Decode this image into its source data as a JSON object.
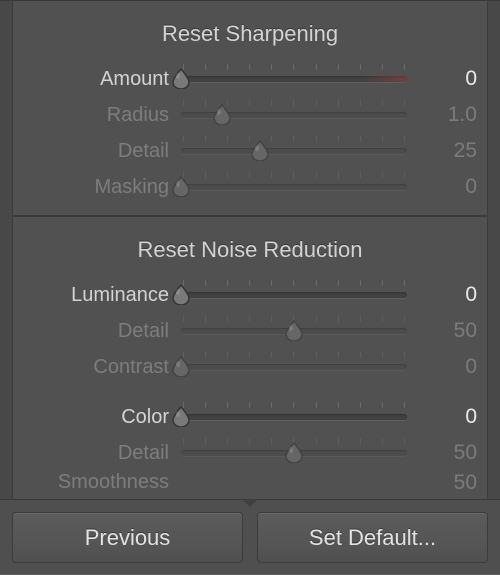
{
  "sections": {
    "sharpening": {
      "title": "Reset Sharpening",
      "rows": [
        {
          "label": "Amount",
          "value": "0",
          "pos": 0.0,
          "enabled": true,
          "redtail": true
        },
        {
          "label": "Radius",
          "value": "1.0",
          "pos": 0.18,
          "enabled": false
        },
        {
          "label": "Detail",
          "value": "25",
          "pos": 0.35,
          "enabled": false
        },
        {
          "label": "Masking",
          "value": "0",
          "pos": 0.0,
          "enabled": false
        }
      ]
    },
    "noise": {
      "title": "Reset Noise Reduction",
      "rows": [
        {
          "label": "Luminance",
          "value": "0",
          "pos": 0.0,
          "enabled": true
        },
        {
          "label": "Detail",
          "value": "50",
          "pos": 0.5,
          "enabled": false
        },
        {
          "label": "Contrast",
          "value": "0",
          "pos": 0.0,
          "enabled": false
        },
        {
          "spacer": true
        },
        {
          "label": "Color",
          "value": "0",
          "pos": 0.0,
          "enabled": true
        },
        {
          "label": "Detail",
          "value": "50",
          "pos": 0.5,
          "enabled": false
        }
      ],
      "cutoff": {
        "label": "Smoothness",
        "value": "50"
      }
    }
  },
  "buttons": {
    "previous": "Previous",
    "set_default": "Set Default..."
  }
}
